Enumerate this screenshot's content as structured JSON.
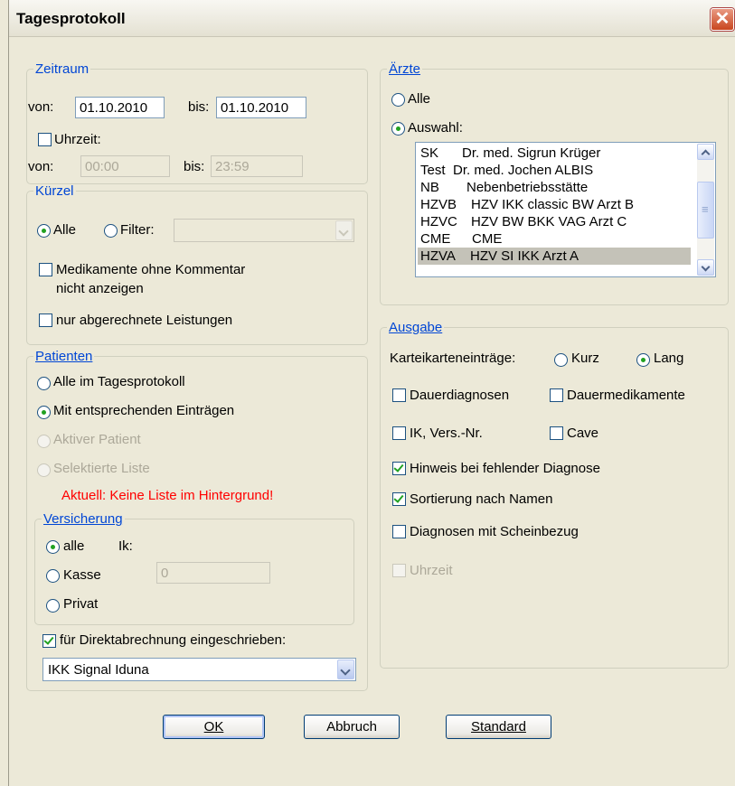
{
  "window": {
    "title": "Tagesprotokoll",
    "close_glyph": "✕"
  },
  "zeitraum": {
    "legend": "Zeitraum",
    "von_label": "von:",
    "von_value": "01.10.2010",
    "bis_label": "bis:",
    "bis_value": "01.10.2010",
    "uhrzeit_label": "Uhrzeit:",
    "uhrzeit_checked": false,
    "von2_label": "von:",
    "von2_value": "00:00",
    "bis2_label": "bis:",
    "bis2_value": "23:59"
  },
  "kuerzel": {
    "legend": "Kürzel",
    "alle_label": "Alle",
    "filter_label": "Filter:",
    "filter_value": "",
    "medikamente_label_1": "Medikamente ohne Kommentar",
    "medikamente_label_2": "nicht anzeigen",
    "abgerechnet_label": "nur abgerechnete Leistungen"
  },
  "patienten": {
    "legend": "Patienten",
    "options": [
      "Alle im Tagesprotokoll",
      "Mit entsprechenden Einträgen",
      "Aktiver Patient",
      "Selektierte Liste"
    ],
    "selected": "Mit entsprechenden Einträgen",
    "hint": "Aktuell: Keine Liste im Hintergrund!",
    "versicherung": {
      "legend": "Versicherung",
      "alle_label": "alle",
      "kasse_label": "Kasse",
      "privat_label": "Privat",
      "ik_label": "Ik:",
      "ik_value": "0"
    },
    "direkt_label": "für Direktabrechnung eingeschrieben:",
    "direkt_checked": true,
    "kasse_select_value": "IKK Signal Iduna"
  },
  "aerzte": {
    "legend": "Ärzte",
    "alle_label": "Alle",
    "auswahl_label": "Auswahl:",
    "list": [
      {
        "code": "SK",
        "name": "Dr. med. Sigrun Krüger"
      },
      {
        "code": "Test",
        "name": "Dr. med. Jochen ALBIS"
      },
      {
        "code": "NB",
        "name": "Nebenbetriebsstätte"
      },
      {
        "code": "HZVB",
        "name": "HZV IKK classic BW Arzt B"
      },
      {
        "code": "HZVC",
        "name": "HZV BW BKK VAG Arzt C"
      },
      {
        "code": "CME",
        "name": "CME"
      },
      {
        "code": "HZVA",
        "name": "HZV SI IKK Arzt A"
      }
    ],
    "selected_code": "HZVA"
  },
  "ausgabe": {
    "legend": "Ausgabe",
    "kartei_label": "Karteikarteneinträge:",
    "kurz_label": "Kurz",
    "lang_label": "Lang",
    "dauerdiagnosen_label": "Dauerdiagnosen",
    "dauermedikamente_label": "Dauermedikamente",
    "ik_vers_label": "IK, Vers.-Nr.",
    "cave_label": "Cave",
    "hinweis_label": "Hinweis bei fehlender Diagnose",
    "sortierung_label": "Sortierung nach Namen",
    "scheinbezug_label": "Diagnosen mit Scheinbezug",
    "uhrzeit_label": "Uhrzeit"
  },
  "buttons": {
    "ok": "OK",
    "abbruch": "Abbruch",
    "standard": "Standard"
  }
}
